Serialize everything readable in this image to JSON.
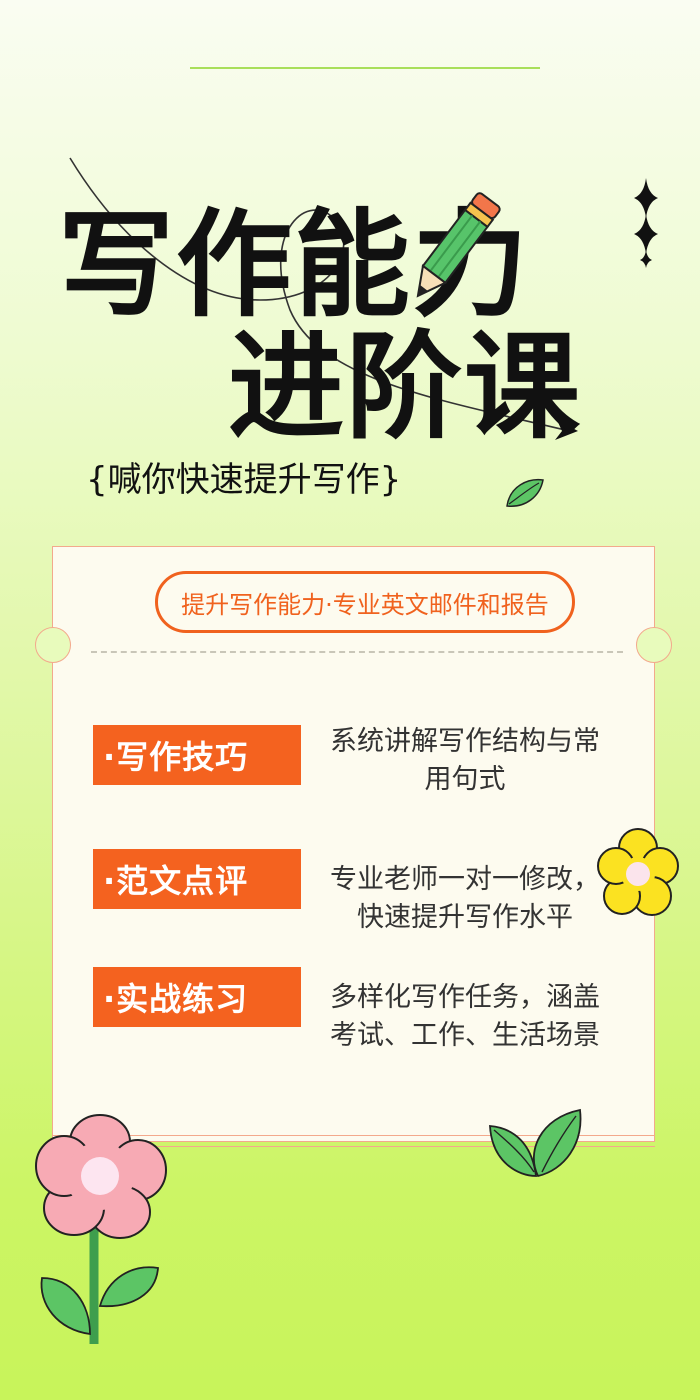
{
  "title": {
    "line1": "写作能力",
    "line2": "进阶课",
    "subtitle": "{喊你快速提升写作}"
  },
  "card": {
    "headline": "提升写作能力·专业英文邮件和报告",
    "features": [
      {
        "tag": "·写作技巧",
        "description": "系统讲解写作结构与常用句式"
      },
      {
        "tag": "·范文点评",
        "description": "专业老师一对一修改，快速提升写作水平"
      },
      {
        "tag": "·实战练习",
        "description": "多样化写作任务，涵盖考试、工作、生活场景"
      }
    ]
  },
  "colors": {
    "accent": "#f4621f",
    "title": "#111111",
    "background_top": "#fafdf2",
    "background_bottom": "#c8f45a",
    "leaf": "#5cc565",
    "flower_yellow": "#fbe221",
    "flower_pink": "#f7aab4"
  },
  "decorations": [
    "pencil-icon",
    "sparkle-icon",
    "leaf-icon",
    "yellow-flower-icon",
    "pink-flower-icon",
    "curved-arrow"
  ]
}
